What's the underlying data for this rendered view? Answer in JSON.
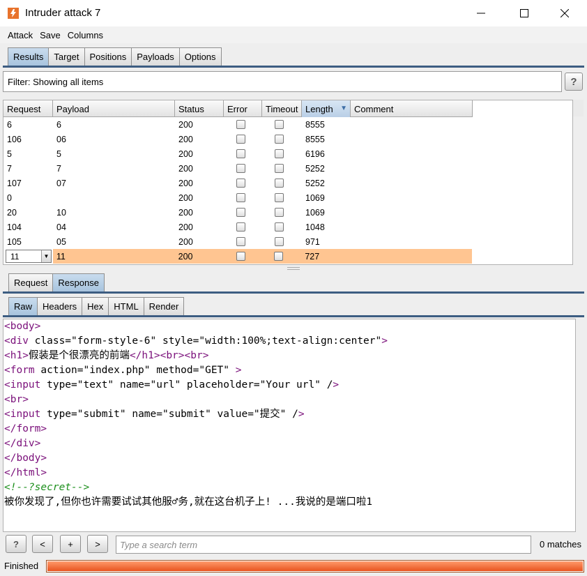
{
  "window": {
    "title": "Intruder attack 7"
  },
  "menu": [
    "Attack",
    "Save",
    "Columns"
  ],
  "main_tabs": [
    {
      "label": "Results",
      "active": true
    },
    {
      "label": "Target",
      "active": false
    },
    {
      "label": "Positions",
      "active": false
    },
    {
      "label": "Payloads",
      "active": false
    },
    {
      "label": "Options",
      "active": false
    }
  ],
  "filter": {
    "text": "Filter: Showing all items"
  },
  "help_label": "?",
  "table": {
    "columns": [
      "Request",
      "Payload",
      "Status",
      "Error",
      "Timeout",
      "Length",
      "Comment"
    ],
    "sorted_column": "Length",
    "rows": [
      {
        "request": "6",
        "payload": "6",
        "status": "200",
        "length": "8555"
      },
      {
        "request": "106",
        "payload": "06",
        "status": "200",
        "length": "8555"
      },
      {
        "request": "5",
        "payload": "5",
        "status": "200",
        "length": "6196"
      },
      {
        "request": "7",
        "payload": "7",
        "status": "200",
        "length": "5252"
      },
      {
        "request": "107",
        "payload": "07",
        "status": "200",
        "length": "5252"
      },
      {
        "request": "0",
        "payload": "",
        "status": "200",
        "length": "1069"
      },
      {
        "request": "20",
        "payload": "10",
        "status": "200",
        "length": "1069"
      },
      {
        "request": "104",
        "payload": "04",
        "status": "200",
        "length": "1048"
      },
      {
        "request": "105",
        "payload": "05",
        "status": "200",
        "length": "971"
      },
      {
        "request": "11",
        "payload": "11",
        "status": "200",
        "length": "727",
        "selected": true
      }
    ]
  },
  "req_resp_tabs": [
    {
      "label": "Request",
      "active": false
    },
    {
      "label": "Response",
      "active": true
    }
  ],
  "view_tabs": [
    {
      "label": "Raw",
      "active": true
    },
    {
      "label": "Headers",
      "active": false
    },
    {
      "label": "Hex",
      "active": false
    },
    {
      "label": "HTML",
      "active": false
    },
    {
      "label": "Render",
      "active": false
    }
  ],
  "response_lines": [
    "<body>",
    "<div class=\"form-style-6\" style=\"width:100%;text-align:center\">",
    "<h1>假装是个很漂亮的前端</h1><br><br>",
    "<form action=\"index.php\" method=\"GET\" >",
    "<input type=\"text\" name=\"url\" placeholder=\"Your url\" />",
    "<br>",
    "<input type=\"submit\" name=\"submit\" value=\"提交\" />",
    "</form>",
    "</div>",
    "</body>",
    "</html>",
    "<!--?secret-->",
    "被你发现了,但你也许需要试试其他服♂务,就在这台机子上! ...我说的是端口啦1"
  ],
  "search": {
    "help_label": "?",
    "prev_label": "<",
    "add_label": "+",
    "next_label": ">",
    "placeholder": "Type a search term",
    "matches": "0 matches"
  },
  "status": {
    "text": "Finished",
    "progress": 1.0
  },
  "colors": {
    "selected_row": "#ffc591",
    "progress_fill": "#e8541f",
    "active_tab": "#a8c4de"
  }
}
